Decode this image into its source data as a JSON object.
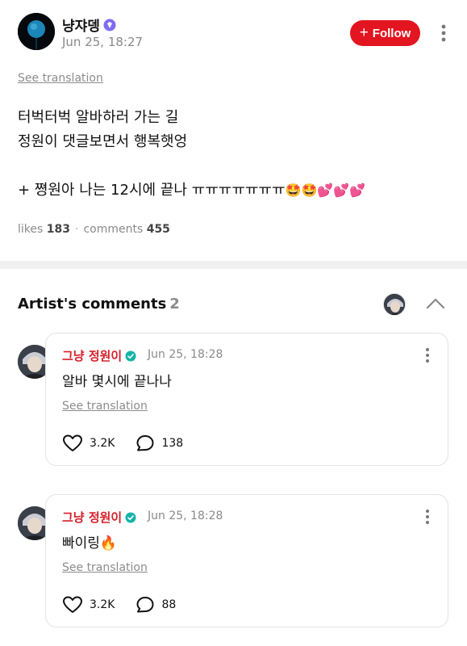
{
  "post": {
    "author": "냥쟈뎅",
    "time": "Jun 25, 18:27",
    "follow_label": "Follow",
    "see_translation": "See translation",
    "lines": [
      "터벅터벅 알바하러 가는 길",
      "정원이 댓글보면서 행복햇엉"
    ],
    "line3_text": "+ 쪙원아 나는 12시에 끝나 ㅠㅠㅠㅠㅠㅠㅠ",
    "line3_emojis": "🤩🤩💕💕💕",
    "likes_label": "likes",
    "likes_count": "183",
    "comments_label": "comments",
    "comments_count": "455"
  },
  "artist_comments": {
    "title": "Artist's comments",
    "count": "2",
    "items": [
      {
        "name": "그냥 정원이",
        "time": "Jun 25, 18:28",
        "text": "알바 몇시에 끝나나",
        "see_translation": "See translation",
        "likes": "3.2K",
        "replies": "138"
      },
      {
        "name": "그냥 정원이",
        "time": "Jun 25, 18:28",
        "text": "빠이링🔥",
        "see_translation": "See translation",
        "likes": "3.2K",
        "replies": "88"
      }
    ]
  },
  "colors": {
    "follow_button": "#e21520",
    "artist_name": "#d6202b",
    "verified_badge": "#15b3a7",
    "author_badge": "#7d6cf0"
  },
  "icons": {
    "author_badge": "verified-diamond-icon",
    "artist_badge": "verified-check-icon",
    "more": "more-vertical-icon",
    "collapse": "chevron-up-icon",
    "like": "heart-outline-icon",
    "reply": "speech-bubble-icon"
  }
}
